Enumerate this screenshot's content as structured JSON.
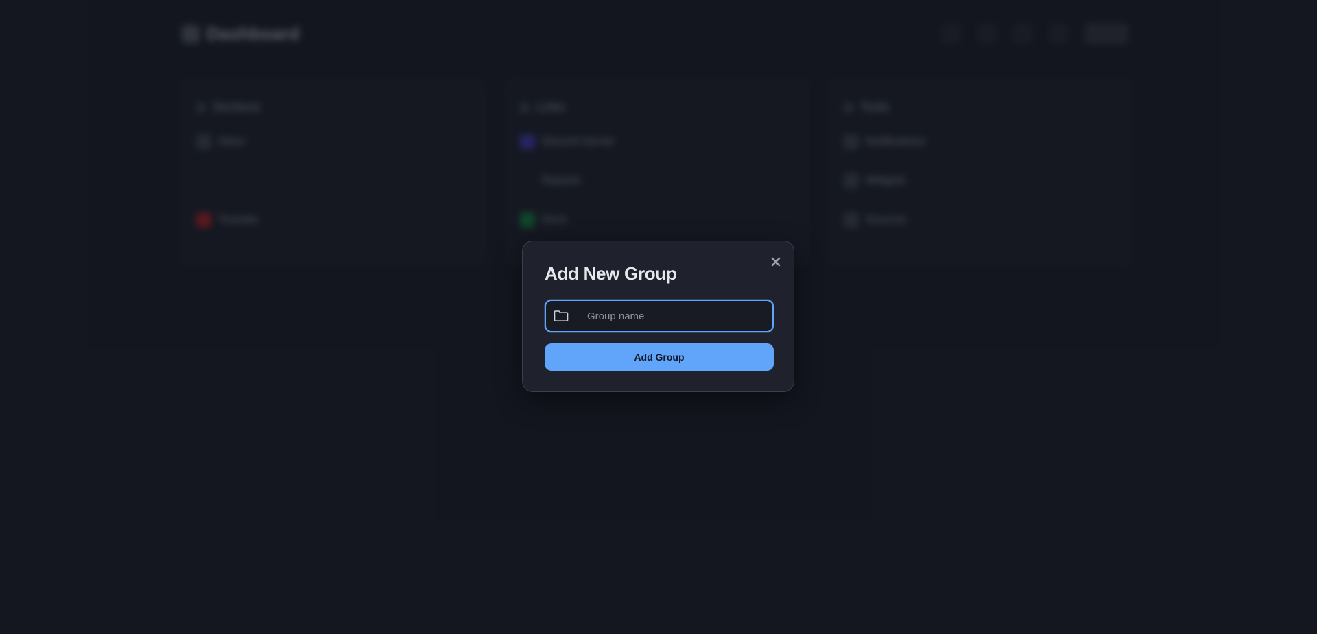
{
  "background": {
    "brand": {
      "name": "Dashboard"
    },
    "columns": [
      {
        "title": "Sections",
        "items": [
          {
            "label": "Inbox",
            "color": "#6b7280"
          },
          {
            "label": "",
            "color": "transparent"
          },
          {
            "label": "Youtube",
            "color": "#dc2626"
          }
        ]
      },
      {
        "title": "Links",
        "items": [
          {
            "label": "Discord Server",
            "color": "#4f46e5"
          },
          {
            "label": "Reports",
            "color": "transparent"
          },
          {
            "label": "Docs",
            "color": "#16a34a"
          }
        ]
      },
      {
        "title": "Tools",
        "items": [
          {
            "label": "Notifications",
            "color": "#6b7280"
          },
          {
            "label": "Widgets",
            "color": "#6b7280"
          },
          {
            "label": "Sources",
            "color": "#6b7280"
          }
        ]
      }
    ]
  },
  "modal": {
    "title": "Add New Group",
    "close_icon": "close-icon",
    "input": {
      "placeholder": "Group name",
      "value": "",
      "icon": "folder-icon"
    },
    "submit_label": "Add Group"
  },
  "colors": {
    "accent": "#60a5fa",
    "page_bg": "#1a1d27",
    "modal_bg": "#1f222c"
  }
}
